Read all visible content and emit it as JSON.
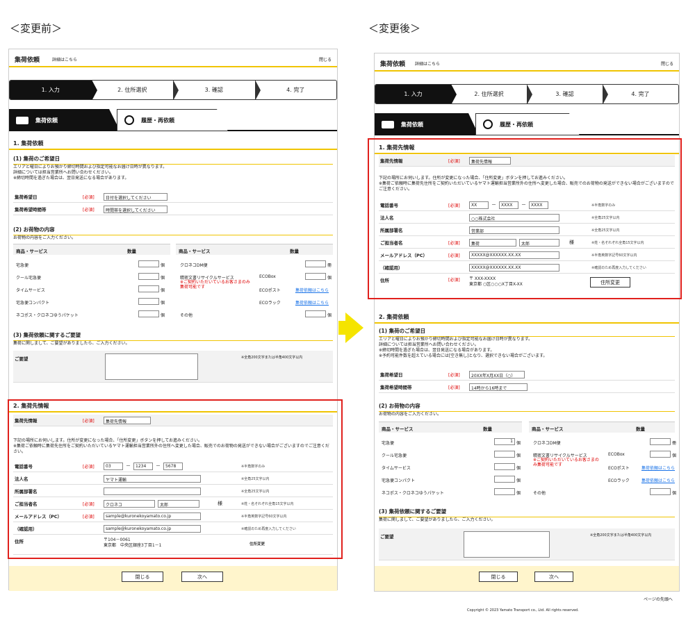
{
  "captions": {
    "before": "＜変更前＞",
    "after": "＜変更後＞"
  },
  "header": {
    "title": "集荷依頼",
    "link": "詳細はこちら",
    "close": "閉じる"
  },
  "steps": [
    "1. 入力",
    "2. 住所選択",
    "3. 確認",
    "4. 完了"
  ],
  "tabs": {
    "request": "集荷依頼",
    "history": "履歴・再依頼"
  },
  "sections": {
    "s1": "1. 集荷依頼",
    "s1_after": "1. 集荷先情報",
    "s2_before": "2. 集荷先情報",
    "s2_after": "2. 集荷依頼"
  },
  "wish": {
    "title": "(1) 集荷のご希望日",
    "text": [
      "エリアと曜日によりお預かり締切時間および指定可能なお届け日時が異なります。",
      "詳細については担当営業所へお問い合わせください。",
      "※締切時間を過ぎた場合は、翌日発送になる場合があります。"
    ],
    "text_after_extra": "※予約可能件数を超えている場合には[空き無し]となり、選択できない場合がございます。",
    "date_label": "集荷希望日",
    "time_label": "集荷希望時間帯",
    "required": "[必須]",
    "date_ph": "日付を選択してください",
    "time_ph": "時間帯を選択してください",
    "date_val": "20XX年X月XX日（○）",
    "time_val": "14時から16時まで"
  },
  "items": {
    "title": "(2) お荷物の内容",
    "text": "お荷物の内容をご入力ください。",
    "col_item": "商品・サービス",
    "col_qty": "数量",
    "left": [
      "宅急便",
      "クール宅急便",
      "タイムサービス",
      "宅急便コンパクト",
      "ネコポス・クロネコゆうパケット"
    ],
    "right": [
      "クロネコDM便",
      "精密文書リサイクルサービス",
      "その他"
    ],
    "notice": "※ご契約いただいているお客さまのみ集荷可能です",
    "eco": [
      "ECOBox",
      "ECOポスト",
      "ECOラック"
    ],
    "link": "集荷依頼はこちら",
    "unit": "個",
    "unit_dm": "冊",
    "qty_first": "1"
  },
  "notes": {
    "title": "(3) 集荷依頼に関するご要望",
    "text": "集荷に関しまして、ご要望がありましたら、ご入力ください。",
    "label": "ご要望",
    "hint": "※全角200文字または半角400文字以内"
  },
  "shipper": {
    "label": "集荷先情報",
    "select": "集荷先情報",
    "text": [
      "下記の場所にお伺いします。住所が変更になった場合、「住所変更」ボタンを押してお進みください。",
      "※集荷ご依頼時に集荷先住所をご契約いただいているヤマト運輸担当営業所外の住所へ変更した場合、販売でのお荷物の発送ができない場合がございますのでご注意ください。"
    ],
    "phone_label": "電話番号",
    "company_label": "法人名",
    "dept_label": "所属部署名",
    "person_label": "ご担当者名",
    "mail_label": "メールアドレス（PC）",
    "confirm_label": "（確認用）",
    "addr_label": "住所",
    "hint_phone": "※半角数字のみ",
    "hint_company": "※全角25文字以内",
    "hint_dept": "※全角25文字以内",
    "hint_person": "※姓・名それぞれ全角15文字以内",
    "hint_mail": "※半角英数字記号60文字以内",
    "hint_confirm": "※確認のため再度入力してください",
    "sama": "様",
    "addr_btn": "住所変更",
    "before": {
      "p1": "03",
      "p2": "1234",
      "p3": "5678",
      "company": "ヤマト運輸",
      "dept": "",
      "last": "クロネコ",
      "first": "太郎",
      "mail": "sample@kuronekoyamato.co.jp",
      "mail2": "sample@kuronekoyamato.co.jp",
      "zip": "〒104－0061",
      "addr": "東京都　中央区銀座3丁目1－1"
    },
    "after": {
      "p1": "XX",
      "p2": "XXXX",
      "p3": "XXXX",
      "company": "○○株式会社",
      "dept": "営業部",
      "last": "集荷",
      "first": "太郎",
      "mail": "XXXXX@XXXXXX.XX.XX",
      "mail2": "XXXXX@XXXXXX.XX.XX",
      "zip": "〒 XXX-XXXX",
      "addr": "東京都 ○区○○○X丁目X-XX"
    }
  },
  "footer": {
    "close": "閉じる",
    "next": "次へ",
    "top": "ページの先頭へ",
    "copyright": "Copyright © 2023 Yamato Transport co., Ltd. All rights reserved."
  },
  "colors": {
    "accent": "#f0c400",
    "red": "#e0201c",
    "arrow": "#f5e400"
  }
}
